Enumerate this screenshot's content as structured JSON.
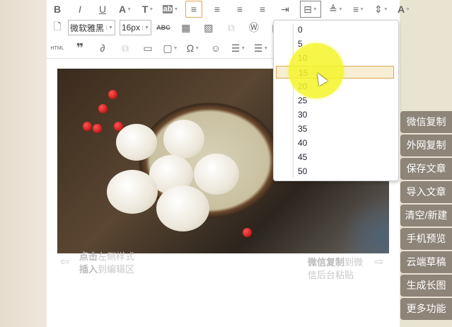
{
  "toolbar": {
    "row1": [
      "bold-icon",
      "italic-icon",
      "underline-icon",
      "font-color-icon",
      "text-format-icon",
      "highlight-icon",
      "align-left-icon",
      "align-center-icon",
      "align-right-icon",
      "justify-icon",
      "indent-icon",
      "page-margin-icon",
      "line-spacing-top-icon",
      "line-spacing-bottom-icon",
      "line-height-icon",
      "letter-spacing-icon"
    ],
    "font_family": "微软雅黑",
    "font_size": "16px",
    "html_label": "HTML"
  },
  "dropdown": {
    "options": [
      "0",
      "5",
      "10",
      "15",
      "20",
      "25",
      "30",
      "35",
      "40",
      "45",
      "50"
    ],
    "highlighted": "15"
  },
  "hints": {
    "left_bold": "点击",
    "left_1": "左侧样式",
    "left_2_bold": "插入",
    "left_2": "到编辑区",
    "right_bold": "微信复制",
    "right_1": "到微",
    "right_2": "信后台粘贴"
  },
  "side_buttons": [
    "微信复制",
    "外网复制",
    "保存文章",
    "导入文章",
    "清空/新建",
    "手机预览",
    "云端草稿",
    "生成长图",
    "更多功能"
  ],
  "colors": {
    "accent": "#e0a850",
    "side_button": "#8e8478"
  }
}
